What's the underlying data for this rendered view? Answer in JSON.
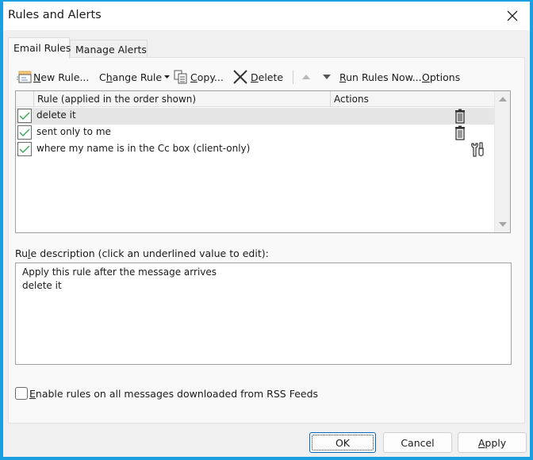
{
  "window": {
    "title": "Rules and Alerts",
    "close_label": "Close"
  },
  "tabs": [
    {
      "label": "Email Rules",
      "active": true
    },
    {
      "label": "Manage Alerts",
      "active": false
    }
  ],
  "toolbar": {
    "new_rule": {
      "prefix": "",
      "mnemonic": "N",
      "rest": "ew Rule..."
    },
    "change_rule": {
      "prefix": "C",
      "mnemonic": "h",
      "rest": "ange Rule"
    },
    "copy": {
      "prefix": "",
      "mnemonic": "C",
      "rest": "opy..."
    },
    "delete": {
      "prefix": "",
      "mnemonic": "D",
      "rest": "elete"
    },
    "move_up_label": "Move Up",
    "move_down_label": "Move Down",
    "run_rules_now": {
      "prefix": "",
      "mnemonic": "R",
      "rest": "un Rules Now..."
    },
    "options": {
      "prefix": "",
      "mnemonic": "O",
      "rest": "ptions"
    }
  },
  "rules_list": {
    "columns": [
      "Rule (applied in the order shown)",
      "Actions"
    ],
    "rows": [
      {
        "name": "delete it",
        "enabled": true,
        "selected": true,
        "action_icon": "trash-icon"
      },
      {
        "name": "sent only to me",
        "enabled": true,
        "selected": false,
        "action_icon": "trash-icon"
      },
      {
        "name": "where my name is in the Cc box  (client-only)",
        "enabled": true,
        "selected": false,
        "action_icon": "wrench-screwdriver-icon"
      }
    ]
  },
  "description": {
    "label_prefix": "Ru",
    "label_mnemonic": "l",
    "label_rest": "e description (click an underlined value to edit):",
    "lines": [
      "Apply this rule after the message arrives",
      "delete it"
    ]
  },
  "rss_option": {
    "mnemonic": "E",
    "rest": "nable rules on all messages downloaded from RSS Feeds",
    "checked": false
  },
  "buttons": {
    "ok": "OK",
    "cancel": "Cancel",
    "apply_mnemonic": "A",
    "apply_rest": "pply"
  },
  "colors": {
    "accent": "#1a9fe0",
    "check_green": "#3aa757",
    "selected_row": "#e5e5e5"
  }
}
